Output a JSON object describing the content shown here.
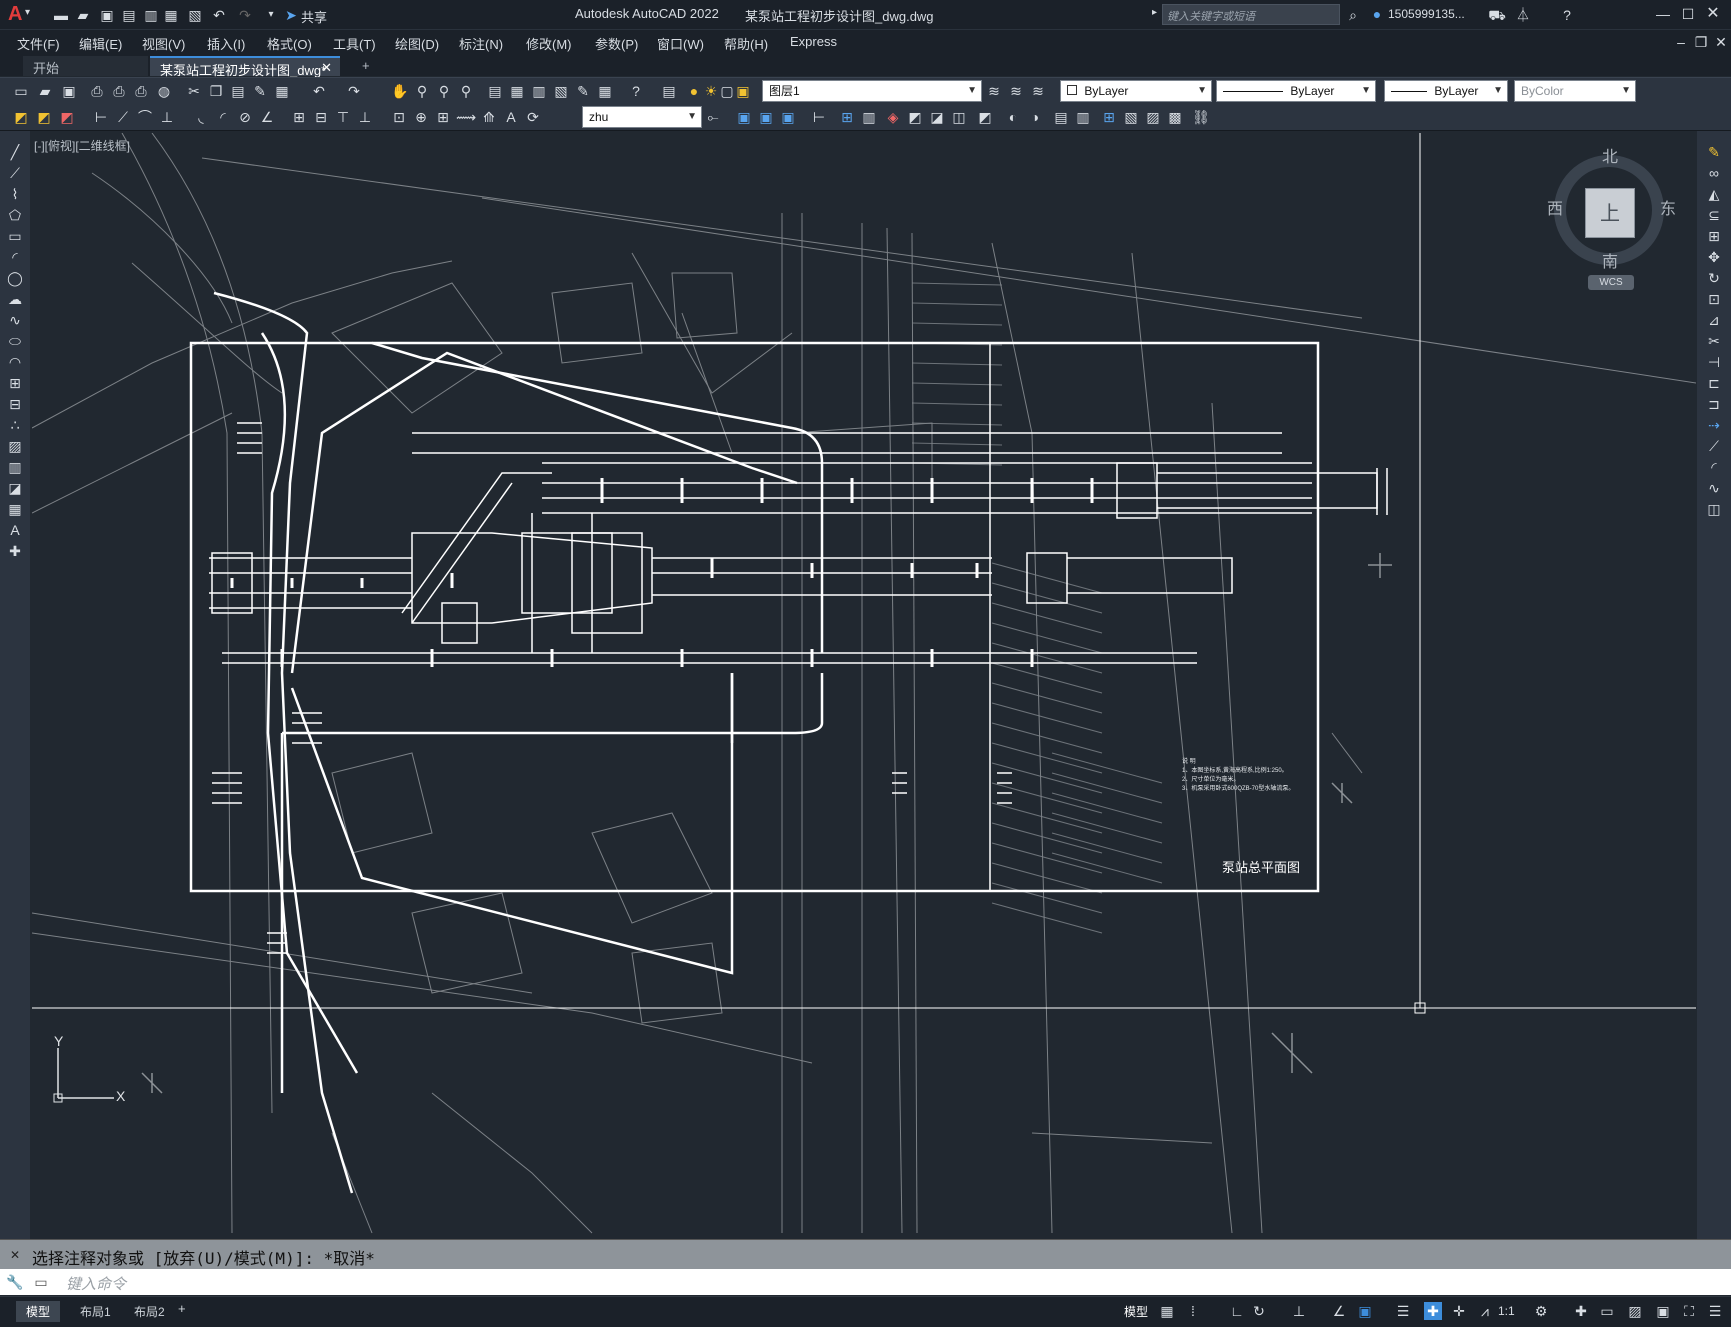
{
  "app": {
    "title": "Autodesk AutoCAD 2022",
    "document_title": "某泵站工程初步设计图_dwg.dwg",
    "share_label": "共享",
    "search_placeholder": "键入关键字或短语",
    "user_name": "1505999135...",
    "logo_letter": "A"
  },
  "menu": [
    "文件(F)",
    "编辑(E)",
    "视图(V)",
    "插入(I)",
    "格式(O)",
    "工具(T)",
    "绘图(D)",
    "标注(N)",
    "修改(M)",
    "参数(P)",
    "窗口(W)",
    "帮助(H)",
    "Express"
  ],
  "tabs": {
    "start": "开始",
    "active": "某泵站工程初步设计图_dwg*",
    "add": "+"
  },
  "toolbar": {
    "layer_name": "图层1",
    "color": "ByLayer",
    "linetype": "ByLayer",
    "lineweight": "ByLayer",
    "plotstyle": "ByColor",
    "text_style": "zhu"
  },
  "viewport": {
    "label": "[-][俯视][二维线框]",
    "viewcube": {
      "north": "北",
      "south": "南",
      "east": "东",
      "west": "西",
      "top": "上",
      "wcs": "WCS"
    },
    "ucs": {
      "x": "X",
      "y": "Y"
    }
  },
  "drawing": {
    "title": "泵站总平面图",
    "notes": [
      "说  明",
      "1、本图坐标系,黄海高程系,比例1:250。",
      "2、尺寸单位为毫米。",
      "3、机泵采用卧式600QZB-70型水轴流泵。"
    ]
  },
  "command": {
    "history": "选择注释对象或 [放弃(U)/模式(M)]: *取消*",
    "placeholder": "键入命令"
  },
  "status": {
    "layout_tabs": [
      "模型",
      "布局1",
      "布局2"
    ],
    "add": "+",
    "model_label": "模型",
    "scale": "1:1"
  },
  "colors": {
    "background": "#212830",
    "panel": "#2c3440",
    "line_white": "#ffffff",
    "line_gray": "#8c9196",
    "accent": "#3d8ddb"
  }
}
